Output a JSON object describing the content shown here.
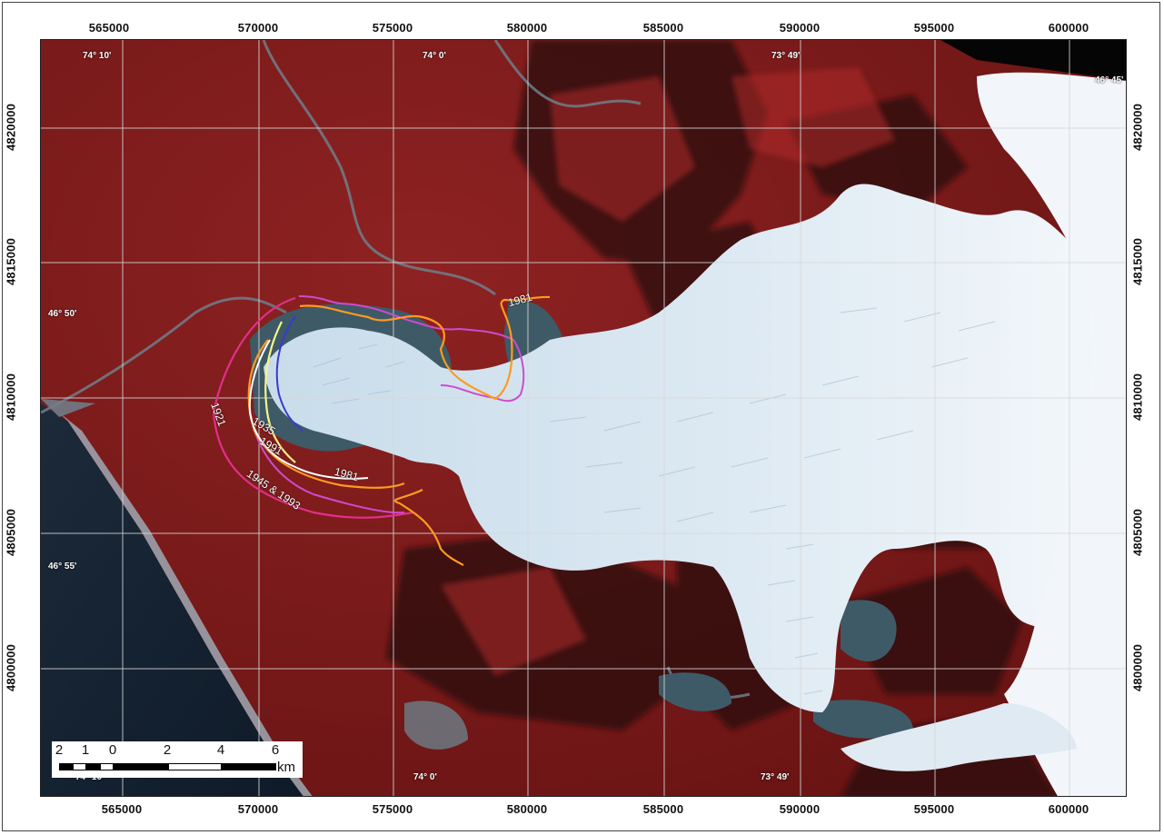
{
  "x_ticks": [
    "565000",
    "570000",
    "575000",
    "580000",
    "585000",
    "590000",
    "595000",
    "600000"
  ],
  "y_ticks": [
    "4820000",
    "4815000",
    "4810000",
    "4805000",
    "4800000"
  ],
  "geo_labels": {
    "lon_w10": "74° 10'",
    "lon_w0": "74° 0'",
    "lon_w49": "73° 49'",
    "lat_45": "46° 45'",
    "lat_50": "46° 50'",
    "lat_55": "46° 55'"
  },
  "year_labels": [
    "1921",
    "1935",
    "1991",
    "1945 & 1993",
    "1981",
    "1981"
  ],
  "scale": {
    "labels": [
      "2",
      "1",
      "0",
      "2",
      "4",
      "6"
    ],
    "unit": "km"
  },
  "colors": {
    "1921": "#e0308a",
    "1935": "#f4f48a",
    "1945 & 1993": "#d04ad0",
    "1981": "#ff9a1e",
    "1991": "#ffffff",
    "other": "#3a3acc"
  }
}
